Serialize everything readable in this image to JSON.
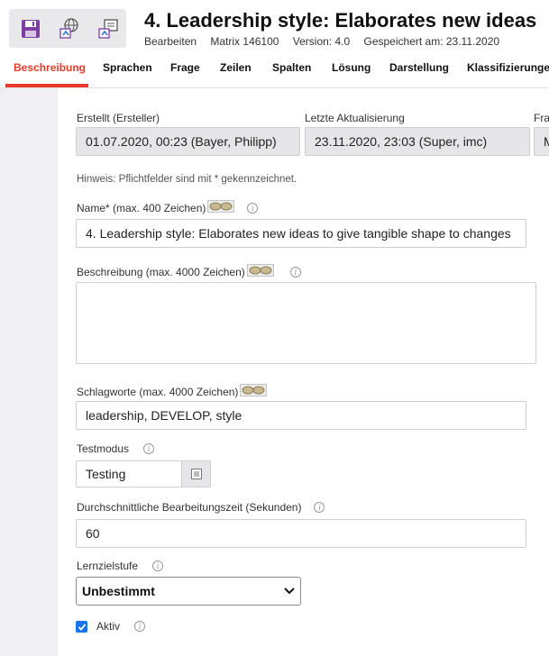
{
  "header": {
    "title": "4. Leadership style: Elaborates new ideas",
    "meta": {
      "status": "Bearbeiten",
      "matrix": "Matrix 146100",
      "version": "Version: 4.0",
      "saved": "Gespeichert am: 23.11.2020"
    },
    "toolbar": [
      "save-icon",
      "publish-web-icon",
      "export-icon"
    ]
  },
  "tabs": [
    {
      "label": "Beschreibung",
      "active": true
    },
    {
      "label": "Sprachen"
    },
    {
      "label": "Frage"
    },
    {
      "label": "Zeilen"
    },
    {
      "label": "Spalten"
    },
    {
      "label": "Lösung"
    },
    {
      "label": "Darstellung"
    },
    {
      "label": "Klassifizierungen"
    }
  ],
  "form": {
    "created": {
      "label": "Erstellt (Ersteller)",
      "value": "01.07.2020, 00:23 (Bayer, Philipp)"
    },
    "updated": {
      "label": "Letzte Aktualisierung",
      "value": "23.11.2020, 23:03 (Super, imc)"
    },
    "third": {
      "label": "Fra",
      "value": "M"
    },
    "hint": "Hinweis: Pflichtfelder sind mit * gekennzeichnet.",
    "name": {
      "label": "Name* (max. 400 Zeichen)",
      "value": "4. Leadership style: Elaborates new ideas to give tangible shape to changes"
    },
    "description": {
      "label": "Beschreibung (max. 4000 Zeichen)",
      "value": ""
    },
    "keywords": {
      "label": "Schlagworte (max. 4000 Zeichen)",
      "value": "leadership, DEVELOP, style"
    },
    "testmode": {
      "label": "Testmodus",
      "value": "Testing"
    },
    "avg_time": {
      "label": "Durchschnittliche Bearbeitungszeit (Sekunden)",
      "value": "60"
    },
    "level": {
      "label": "Lernzielstufe",
      "value": "Unbestimmt"
    },
    "active": {
      "label": "Aktiv",
      "checked": true
    }
  },
  "colors": {
    "accent": "#e8392b",
    "checkbox": "#1a73e8"
  }
}
